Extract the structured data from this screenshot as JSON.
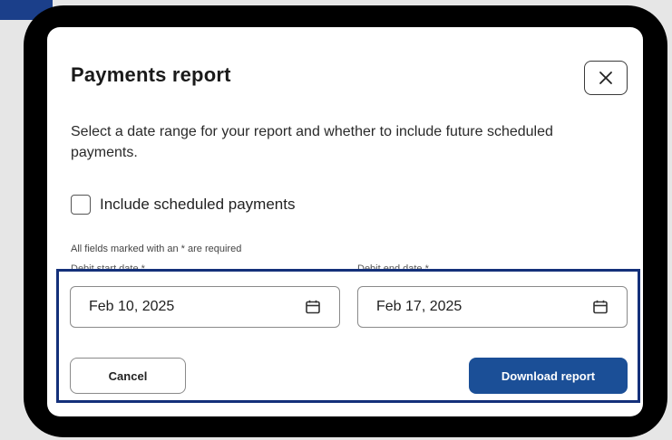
{
  "modal": {
    "title": "Payments report",
    "description": "Select a date range for your report and whether to include future scheduled payments.",
    "checkbox": {
      "label": "Include scheduled payments",
      "checked": false
    },
    "required_note": "All fields marked with an * are required",
    "fields": {
      "start": {
        "label": "Debit start date *",
        "value": "Feb 10, 2025",
        "icon": "calendar-icon"
      },
      "end": {
        "label": "Debit end date *",
        "value": "Feb 17, 2025",
        "icon": "calendar-icon"
      }
    },
    "buttons": {
      "cancel": "Cancel",
      "download": "Download report"
    },
    "close_icon": "close-icon"
  },
  "colors": {
    "primary_button": "#1b4f97",
    "highlight_border": "#14307a",
    "frame": "#000000",
    "background": "#e6e6e6"
  }
}
